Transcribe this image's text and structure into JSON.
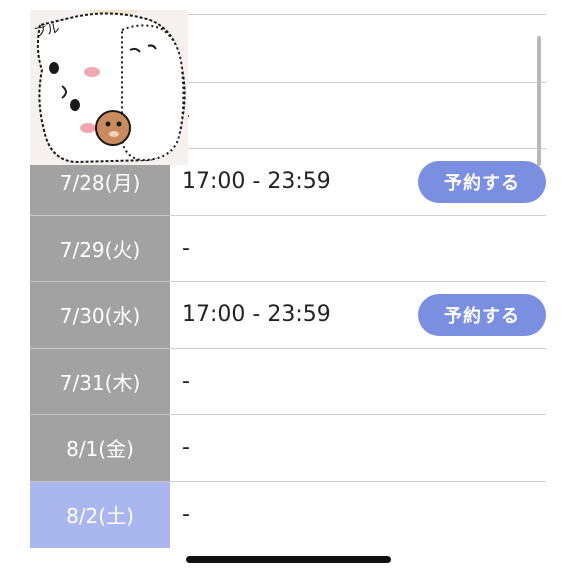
{
  "schedule": {
    "rows": [
      {
        "date": "",
        "time": ""
      },
      {
        "date": "",
        "time": "-"
      },
      {
        "date": "7/28(月)",
        "time": "17:00 - 23:59",
        "button": "予約する"
      },
      {
        "date": "7/29(火)",
        "time": "-"
      },
      {
        "date": "7/30(水)",
        "time": "17:00 - 23:59",
        "button": "予約する"
      },
      {
        "date": "7/31(木)",
        "time": "-"
      },
      {
        "date": "8/1(金)",
        "time": "-"
      },
      {
        "date": "8/2(土)",
        "time": "-"
      }
    ]
  },
  "sticker": {
    "text": "プル",
    "description_icon": "hamster-sticker-icon"
  },
  "colors": {
    "date_bg": "#a2a2a2",
    "saturday_bg": "#aab7ee",
    "button_bg": "#7b8fe0"
  }
}
